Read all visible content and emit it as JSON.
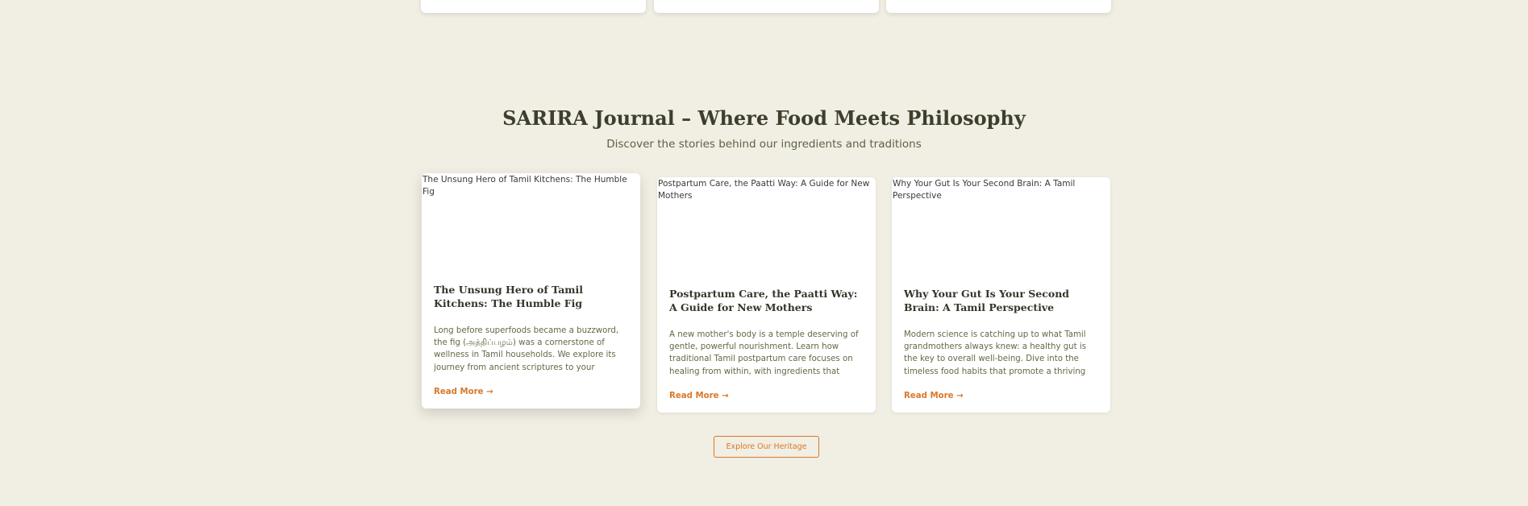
{
  "journal": {
    "title": "SARIRA Journal – Where Food Meets Philosophy",
    "subtitle": "Discover the stories behind our ingredients and traditions",
    "posts": [
      {
        "image_alt": "The Unsung Hero of Tamil Kitchens: The Humble Fig",
        "title": "The Unsung Hero of Tamil Kitchens: The Humble Fig",
        "excerpt": "Long before superfoods became a buzzword, the fig (அத்திப்பழம்) was a cornerstone of wellness in Tamil households. We explore its journey from ancient scriptures to your kitchen.",
        "read_more": "Read More →"
      },
      {
        "image_alt": "Postpartum Care, the Paatti Way: A Guide for New Mothers",
        "title": "Postpartum Care, the Paatti Way: A Guide for New Mothers",
        "excerpt": "A new mother's body is a temple deserving of gentle, powerful nourishment. Learn how traditional Tamil postpartum care focuses on healing from within, with ingredients that",
        "read_more": "Read More →"
      },
      {
        "image_alt": "Why Your Gut Is Your Second Brain: A Tamil Perspective",
        "title": "Why Your Gut Is Your Second Brain: A Tamil Perspective",
        "excerpt": "Modern science is catching up to what Tamil grandmothers always knew: a healthy gut is the key to overall well-being. Dive into the timeless food habits that promote a thriving inner",
        "read_more": "Read More →"
      }
    ],
    "cta_label": "Explore Our Heritage"
  },
  "colors": {
    "background": "#f1eee3",
    "accent": "#d9782a",
    "heading": "#3d3f2c",
    "body_text": "#5f6b45"
  }
}
